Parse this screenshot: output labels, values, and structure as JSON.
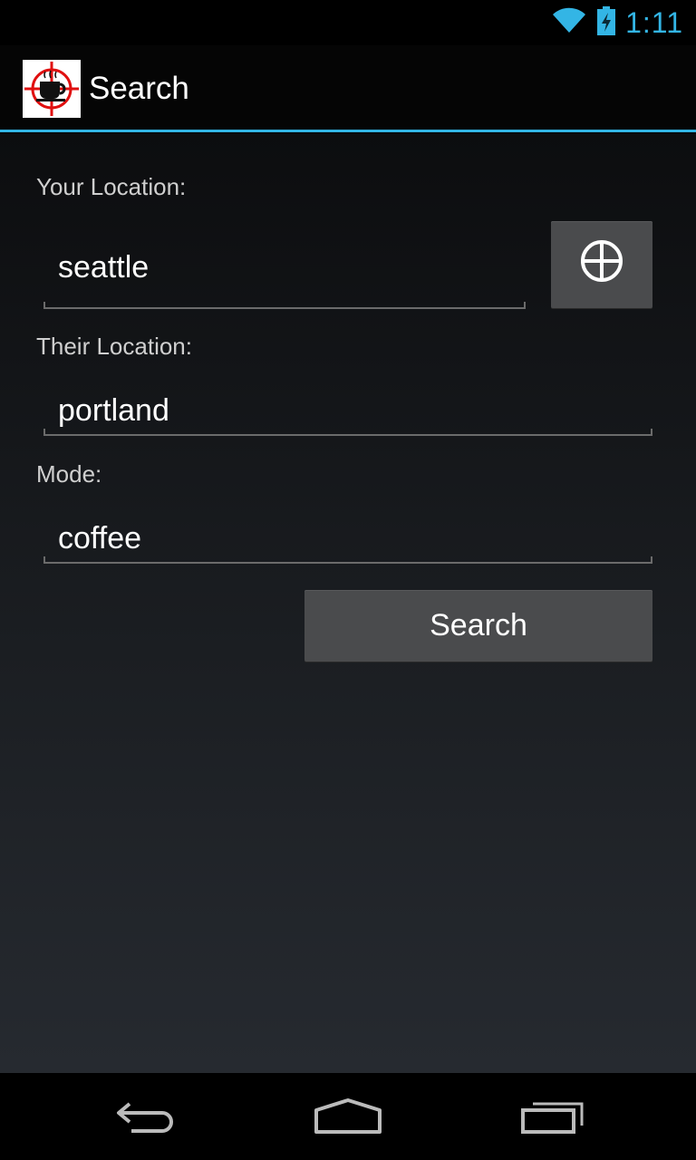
{
  "status_bar": {
    "time": "1:11",
    "icons": [
      "wifi-icon",
      "battery-charging-icon"
    ],
    "accent_color": "#33b5e5"
  },
  "action_bar": {
    "title": "Search",
    "logo_icon": "coffee-target-icon",
    "divider_color": "#33b5e5"
  },
  "form": {
    "your_location_label": "Your Location:",
    "your_location_value": "seattle",
    "locate_button_icon": "crosshair-icon",
    "their_location_label": "Their Location:",
    "their_location_value": "portland",
    "mode_label": "Mode:",
    "mode_value": "coffee",
    "search_button_label": "Search"
  },
  "nav_bar": {
    "icons": [
      "back-icon",
      "home-icon",
      "recent-apps-icon"
    ]
  }
}
